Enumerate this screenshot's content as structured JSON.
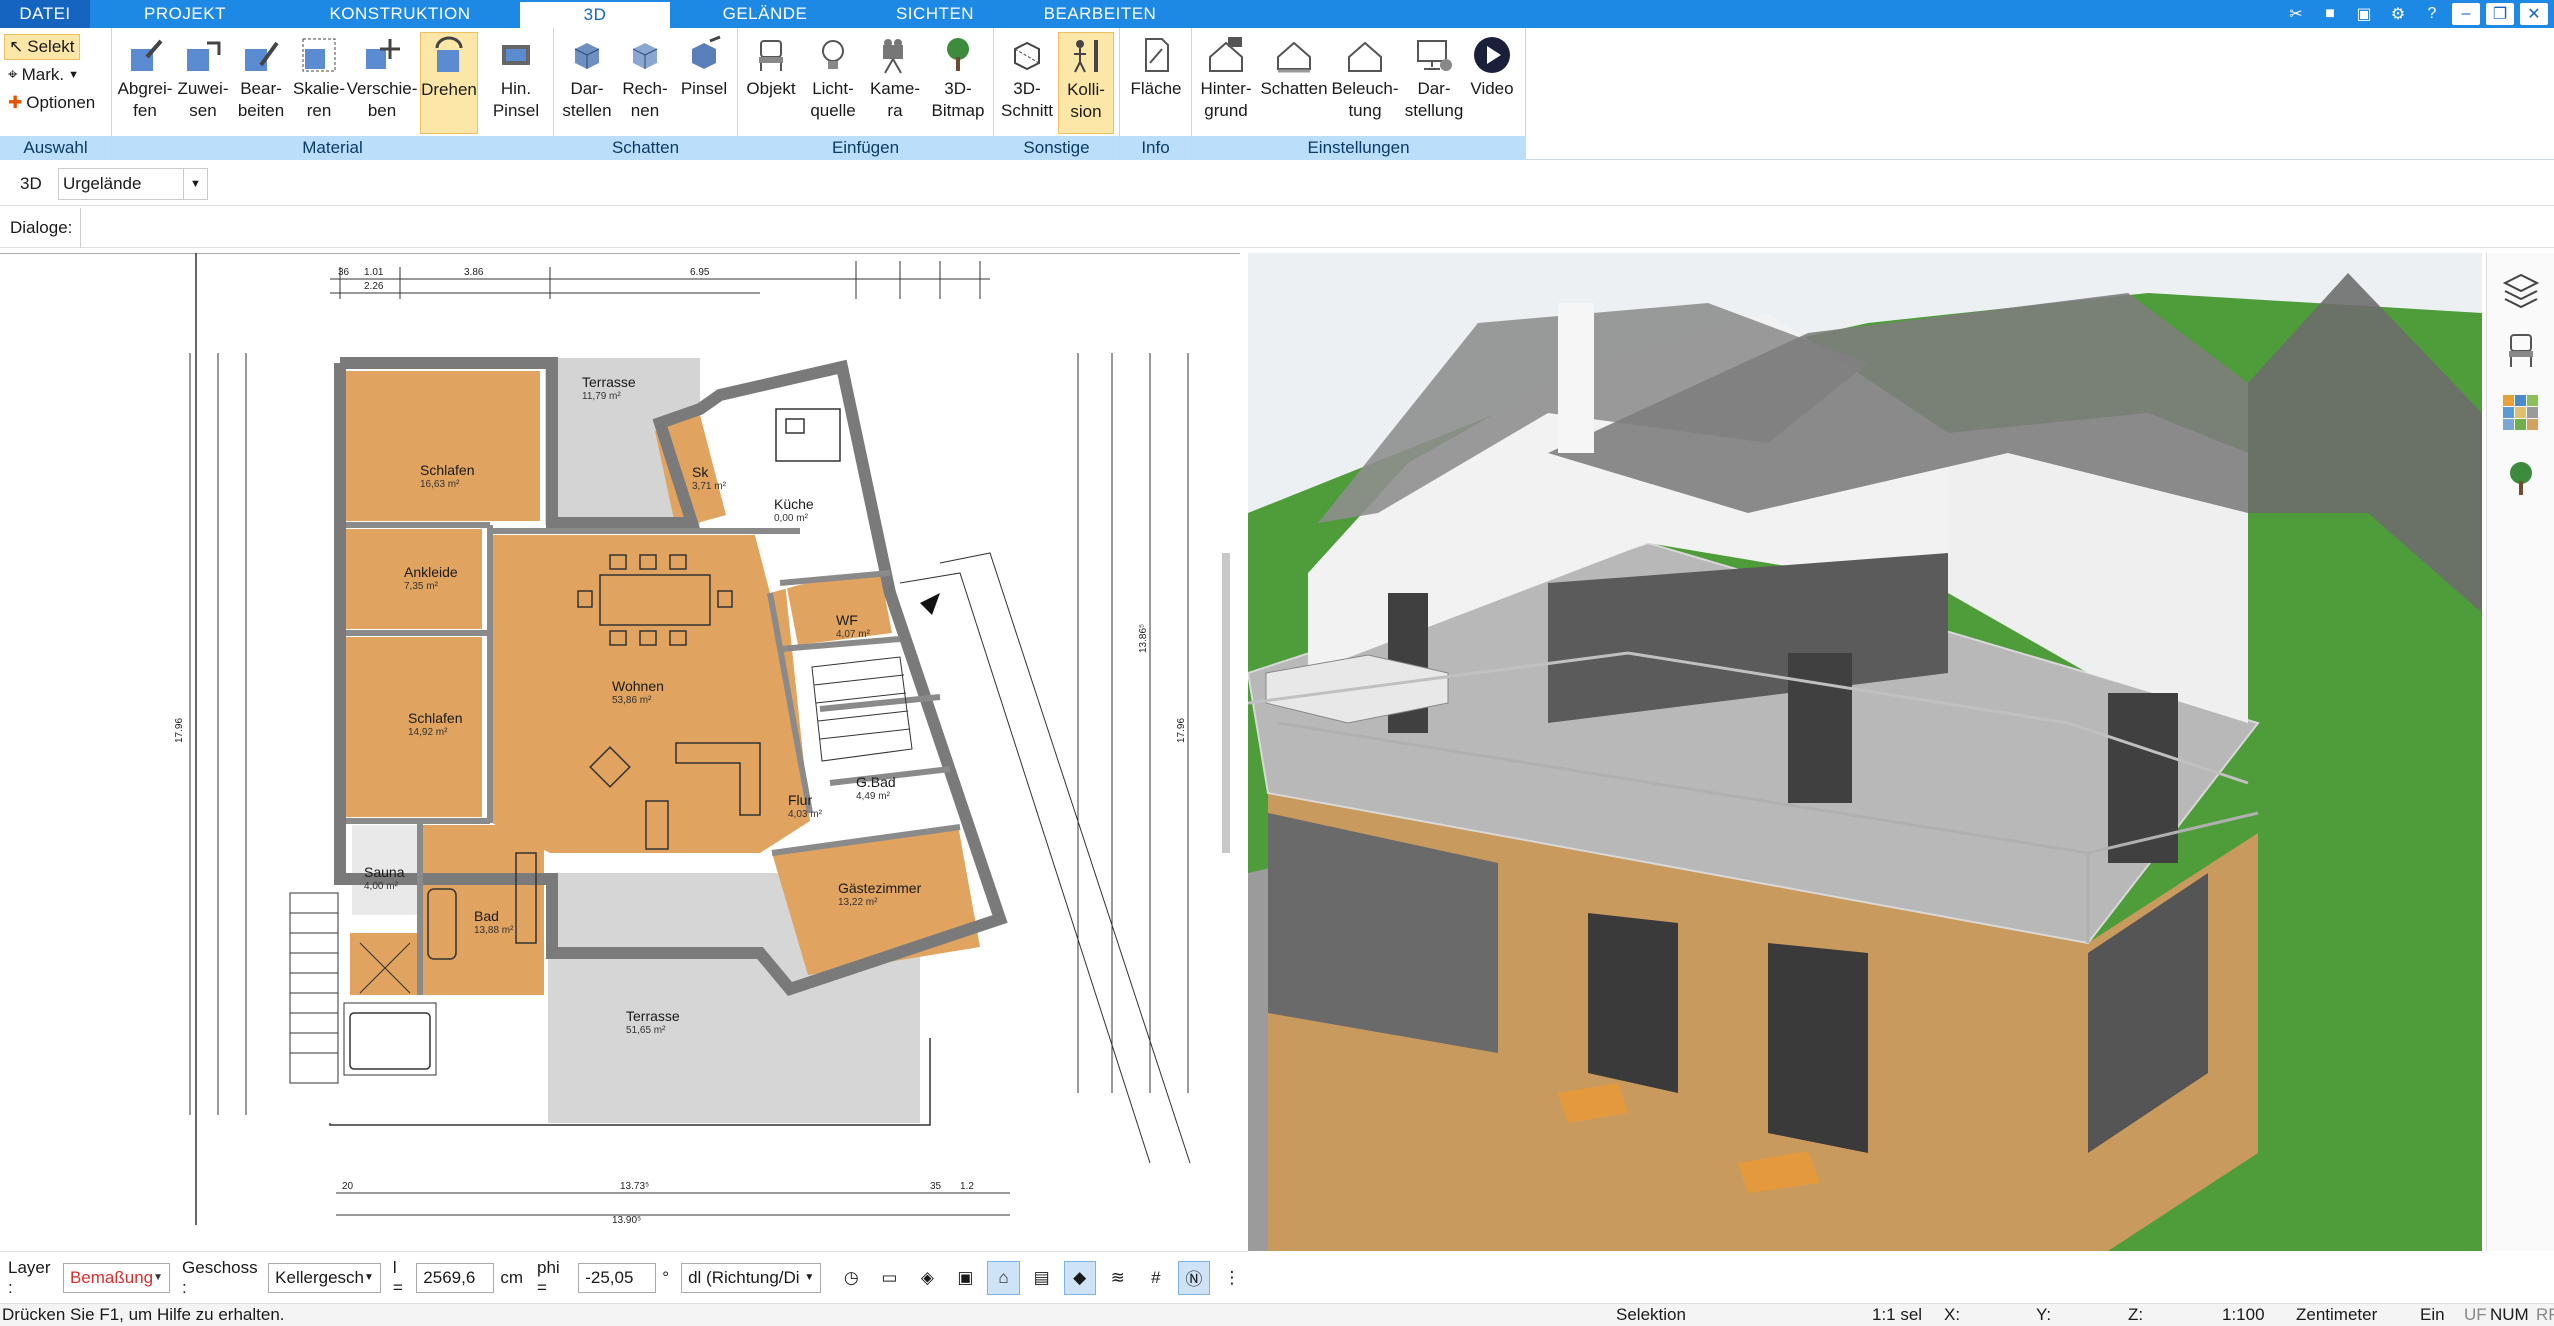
{
  "tabs": [
    "DATEI",
    "PROJEKT",
    "KONSTRUKTION",
    "3D",
    "GELÄNDE",
    "SICHTEN",
    "BEARBEITEN"
  ],
  "active_tab": "3D",
  "ribbon": {
    "auswahl": {
      "label": "Auswahl",
      "items": [
        "Selekt",
        "Mark.",
        "Optionen"
      ]
    },
    "material": {
      "label": "Material",
      "buttons": [
        "Abgrei-\nfen",
        "Zuwei-\nsen",
        "Bear-\nbeiten",
        "Skalie-\nren",
        "Verschie-\nben",
        "Drehen",
        "Hin.\nPinsel"
      ]
    },
    "schatten": {
      "label": "Schatten",
      "buttons": [
        "Dar-\nstellen",
        "Rech-\nnen",
        "Pinsel"
      ]
    },
    "einfuegen": {
      "label": "Einfügen",
      "buttons": [
        "Objekt",
        "Licht-\nquelle",
        "Kame-\nra",
        "3D-\nBitmap"
      ]
    },
    "sonstige": {
      "label": "Sonstige",
      "buttons": [
        "3D-\nSchnitt",
        "Kolli-\nsion"
      ]
    },
    "info": {
      "label": "Info",
      "buttons": [
        "Fläche"
      ]
    },
    "einstellungen": {
      "label": "Einstellungen",
      "buttons": [
        "Hinter-\ngrund",
        "Schatten",
        "Beleuch-\ntung",
        "Dar-\nstellung",
        "Video"
      ]
    }
  },
  "row2": {
    "mode": "3D",
    "select_value": "Urgelände"
  },
  "row3": {
    "label": "Dialoge:"
  },
  "plan": {
    "rooms": [
      {
        "name": "Terrasse",
        "area": "11,79 m²"
      },
      {
        "name": "Schlafen",
        "area": "16,63 m²"
      },
      {
        "name": "Sk",
        "area": "3,71 m²"
      },
      {
        "name": "Küche",
        "area": "0,00 m²"
      },
      {
        "name": "Ankleide",
        "area": "7,35 m²"
      },
      {
        "name": "Wohnen",
        "area": "53,86 m²"
      },
      {
        "name": "WF",
        "area": "4,07 m²"
      },
      {
        "name": "Schlafen",
        "area": "14,92 m²"
      },
      {
        "name": "G.Bad",
        "area": "4,49 m²"
      },
      {
        "name": "Flur",
        "area": "4,03 m²"
      },
      {
        "name": "Gästezimmer",
        "area": "13,22 m²"
      },
      {
        "name": "Sauna",
        "area": "4,00 m²"
      },
      {
        "name": "Bad",
        "area": "13,88 m²"
      },
      {
        "name": "Terrasse",
        "area": "51,65 m²"
      }
    ],
    "top_dims": [
      "36",
      "1.01",
      "2.26",
      "3.86",
      "6.95"
    ],
    "bottom_dims": [
      "20",
      "13.73⁵",
      "35",
      "1.2",
      "13.90⁵"
    ],
    "side_dims": [
      "17.96",
      "17.96",
      "13.86⁵"
    ]
  },
  "status": {
    "layer_label": "Layer :",
    "layer_value": "Bemaßung",
    "geschoss_label": "Geschoss :",
    "geschoss_value": "Kellergesch",
    "l_label": "l =",
    "l_value": "2569,6",
    "l_unit": "cm",
    "phi_label": "phi =",
    "phi_value": "-25,05",
    "phi_unit": "°",
    "dl_value": "dl (Richtung/Di"
  },
  "helpbar": {
    "help": "Drücken Sie F1, um Hilfe zu erhalten.",
    "mode": "Selektion",
    "sel": "1:1 sel",
    "x": "X:",
    "y": "Y:",
    "z": "Z:",
    "scale": "1:100",
    "unit": "Zentimeter",
    "ein": "Ein",
    "uf": "UF",
    "num": "NUM",
    "rf": "RF"
  },
  "colors": {
    "accent": "#1e88e5",
    "ribbon_group": "#bbdefb",
    "active_button": "#fde7a8",
    "floor": "#e0a360"
  }
}
